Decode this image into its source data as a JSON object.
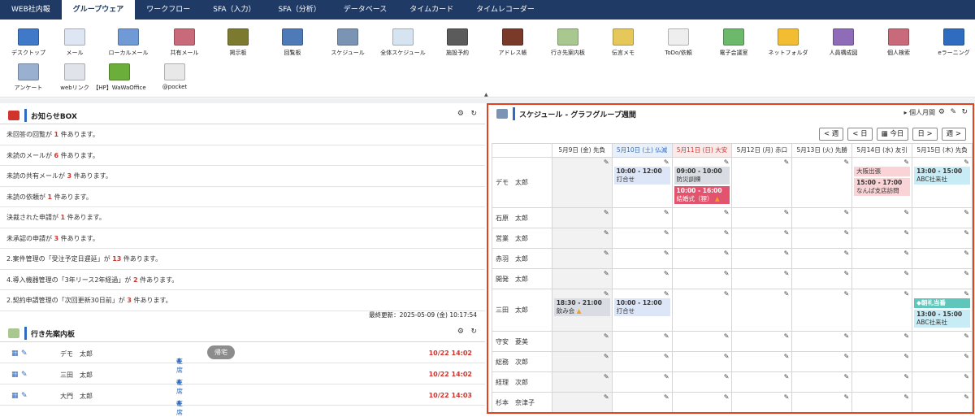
{
  "nav": {
    "tabs": [
      {
        "label": "WEB社内報",
        "active": false
      },
      {
        "label": "グループウェア",
        "active": true
      },
      {
        "label": "ワークフロー",
        "active": false
      },
      {
        "label": "SFA（入力）",
        "active": false
      },
      {
        "label": "SFA（分析）",
        "active": false
      },
      {
        "label": "データベース",
        "active": false
      },
      {
        "label": "タイムカード",
        "active": false
      },
      {
        "label": "タイムレコーダー",
        "active": false
      }
    ]
  },
  "colors": {
    "nav_bg": "#1f3a64",
    "accent": "#2f6cc0",
    "alert": "#d0342c",
    "highlight_border": "#e2421e"
  },
  "toolbar": {
    "items": [
      {
        "label": "デスクトップ",
        "icon": "desktop-icon",
        "color": "#3f79c8"
      },
      {
        "label": "メール",
        "icon": "mail-icon",
        "color": "#dde6f2"
      },
      {
        "label": "ローカルメール",
        "icon": "local-mail-icon",
        "color": "#6f9ad6"
      },
      {
        "label": "共有メール",
        "icon": "shared-mail-icon",
        "color": "#c86a7a"
      },
      {
        "label": "掲示板",
        "icon": "bulletin-board-icon",
        "color": "#7b7a2e"
      },
      {
        "label": "回覧板",
        "icon": "circular-board-icon",
        "color": "#4f7ab8"
      },
      {
        "label": "スケジュール",
        "icon": "calendar-icon",
        "color": "#7c94b4"
      },
      {
        "label": "全体スケジュール",
        "icon": "group-schedule-icon",
        "color": "#d6e4f2"
      },
      {
        "label": "施設予約",
        "icon": "facility-icon",
        "color": "#5b5b5b"
      },
      {
        "label": "アドレス帳",
        "icon": "address-book-icon",
        "color": "#7a3a2a"
      },
      {
        "label": "行き先案内板",
        "icon": "destination-board-icon",
        "color": "#a8c890"
      },
      {
        "label": "伝言メモ",
        "icon": "memo-icon",
        "color": "#e6c85a"
      },
      {
        "label": "ToDo/依頼",
        "icon": "todo-icon",
        "color": "#eeeeee"
      },
      {
        "label": "電子会議室",
        "icon": "meeting-room-icon",
        "color": "#6cb96c"
      },
      {
        "label": "ネットフォルダ",
        "icon": "folder-icon",
        "color": "#f2bd32"
      },
      {
        "label": "人員構成図",
        "icon": "org-chart-icon",
        "color": "#8e6cb8"
      },
      {
        "label": "個人検索",
        "icon": "person-search-icon",
        "color": "#c86a7a"
      },
      {
        "label": "eラーニング",
        "icon": "elearning-icon",
        "color": "#2f6cc0"
      },
      {
        "label": "アンケート",
        "icon": "survey-icon",
        "color": "#9ab0d0"
      },
      {
        "label": "webリンク",
        "icon": "weblink-icon",
        "color": "#e0e4ea"
      },
      {
        "label": "【HP】WaWaOffice",
        "icon": "wawaoffice-icon",
        "color": "#6cae3a"
      },
      {
        "label": "@pocket",
        "icon": "pocket-icon",
        "color": "#e8e8e8"
      }
    ]
  },
  "notice": {
    "title": "お知らせBOX",
    "items": [
      {
        "pre": "未回答の回覧が ",
        "count": "1",
        "post": " 件あります。"
      },
      {
        "pre": "未読のメールが ",
        "count": "6",
        "post": " 件あります。"
      },
      {
        "pre": "未読の共有メールが ",
        "count": "3",
        "post": " 件あります。"
      },
      {
        "pre": "未読の依頼が ",
        "count": "1",
        "post": " 件あります。"
      },
      {
        "pre": "決裁された申請が ",
        "count": "1",
        "post": " 件あります。"
      },
      {
        "pre": "未承認の申請が ",
        "count": "3",
        "post": " 件あります。"
      },
      {
        "pre": "2.案件管理の「受注予定日遅延」が ",
        "count": "13",
        "post": " 件あります。"
      },
      {
        "pre": "4.導入機器管理の「3年リース2年経過」が ",
        "count": "2",
        "post": " 件あります。"
      },
      {
        "pre": "2.契約申請管理の「次回更新30日前」が ",
        "count": "3",
        "post": " 件あります。"
      }
    ],
    "last_updated": "最終更新：2025-05-09 (金) 10:17:54"
  },
  "visits": {
    "title": "行き先案内板",
    "rows": [
      {
        "name": "デモ　太郎",
        "status": "在席",
        "button": "帰宅",
        "time": "10/22 14:02"
      },
      {
        "name": "三田　太郎",
        "status": "在席",
        "button": "",
        "time": "10/22 14:02"
      },
      {
        "name": "大門　太郎",
        "status": "在席",
        "button": "",
        "time": "10/22 14:03"
      }
    ]
  },
  "schedule": {
    "title": "スケジュール - グラフグループ週間",
    "view_link": "個人月間",
    "nav": {
      "prev_week": "< 週",
      "prev_day": "< 日",
      "today": "今日",
      "next_day": "日 >",
      "next_week": "週 >"
    },
    "days": [
      {
        "label": "5月9日 (金) 先負",
        "type": "weekday"
      },
      {
        "label": "5月10日 (土) 仏滅",
        "type": "sat"
      },
      {
        "label": "5月11日 (日) 大安",
        "type": "sun"
      },
      {
        "label": "5月12日 (月) 赤口",
        "type": "weekday"
      },
      {
        "label": "5月13日 (火) 先勝",
        "type": "weekday"
      },
      {
        "label": "5月14日 (水) 友引",
        "type": "weekday"
      },
      {
        "label": "5月15日 (木) 先負",
        "type": "weekday"
      }
    ],
    "members": [
      {
        "name": "デモ　太郎",
        "events": [
          [],
          [
            {
              "time": "10:00 - 12:00",
              "title": "打合せ",
              "color": "blue"
            }
          ],
          [
            {
              "time": "09:00 - 10:00",
              "title": "防災訓練",
              "color": "grey"
            },
            {
              "time": "10:00 - 16:00",
              "title": "結婚式（狸）",
              "color": "red",
              "warn": true
            }
          ],
          [],
          [],
          [
            {
              "time": "",
              "title": "大阪出張",
              "color": "pink"
            },
            {
              "time": "15:00 - 17:00",
              "title": "なんば支店訪問",
              "color": "pink"
            }
          ],
          [
            {
              "time": "13:00 - 15:00",
              "title": "ABC社来社",
              "color": "cyan"
            }
          ]
        ]
      },
      {
        "name": "石原　太郎",
        "events": [
          [],
          [],
          [],
          [],
          [],
          [],
          []
        ]
      },
      {
        "name": "営業　太郎",
        "events": [
          [],
          [],
          [],
          [],
          [],
          [],
          []
        ]
      },
      {
        "name": "赤羽　太郎",
        "events": [
          [],
          [],
          [],
          [],
          [],
          [],
          []
        ]
      },
      {
        "name": "開発　太郎",
        "events": [
          [],
          [],
          [],
          [],
          [],
          [],
          []
        ]
      },
      {
        "name": "三田　太郎",
        "events": [
          [
            {
              "time": "18:30 - 21:00",
              "title": "飲み会",
              "color": "grey",
              "warn": true
            }
          ],
          [
            {
              "time": "10:00 - 12:00",
              "title": "打合せ",
              "color": "blue"
            }
          ],
          [],
          [],
          [],
          [],
          [
            {
              "time": "",
              "title": "◆朝礼当番",
              "color": "teal"
            },
            {
              "time": "13:00 - 15:00",
              "title": "ABC社来社",
              "color": "cyan"
            }
          ]
        ]
      },
      {
        "name": "守安　菱美",
        "events": [
          [],
          [],
          [],
          [],
          [],
          [],
          []
        ]
      },
      {
        "name": "総務　次郎",
        "events": [
          [],
          [],
          [],
          [],
          [],
          [],
          []
        ]
      },
      {
        "name": "経理　次郎",
        "events": [
          [],
          [],
          [],
          [],
          [],
          [],
          []
        ]
      },
      {
        "name": "杉本　奈津子",
        "events": [
          [],
          [],
          [],
          [],
          [],
          [],
          []
        ]
      }
    ]
  }
}
